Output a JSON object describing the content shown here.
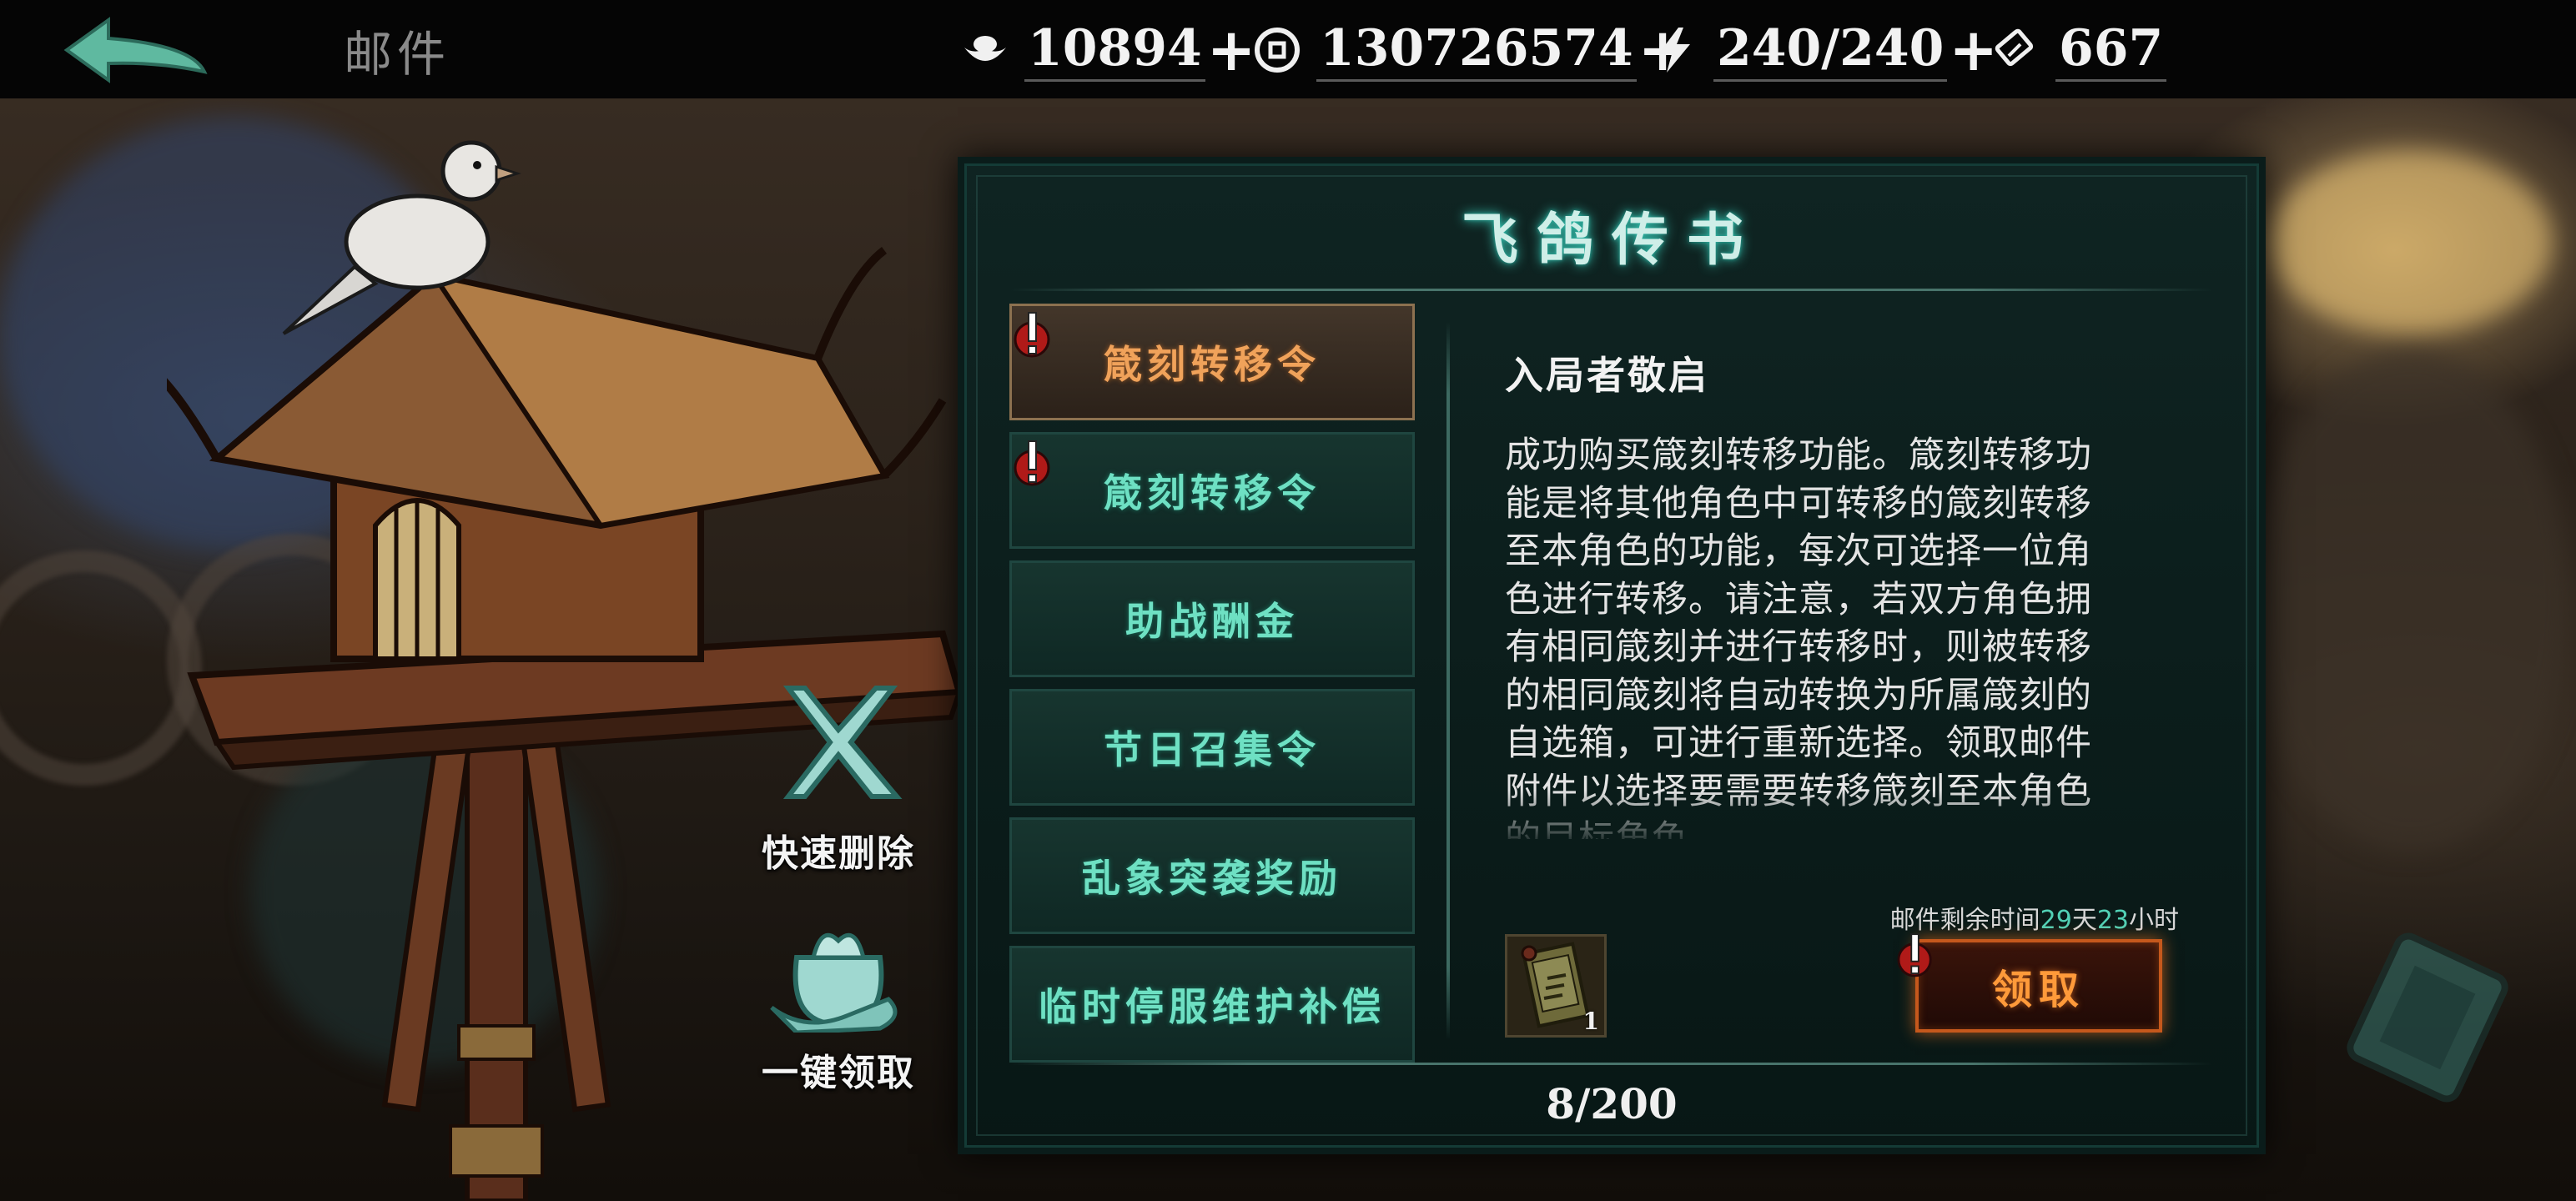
{
  "header": {
    "title": "邮件",
    "currencies": [
      {
        "icon": "ingot-icon",
        "value": "10894"
      },
      {
        "icon": "coin-icon",
        "value": "130726574"
      },
      {
        "icon": "lightning-icon",
        "value": "240/240"
      },
      {
        "icon": "ticket-icon",
        "value": "667"
      }
    ],
    "plus": "+"
  },
  "side_actions": {
    "quick_delete": "快速删除",
    "claim_all": "一键领取"
  },
  "panel": {
    "title": "飞鸽传书",
    "mails": [
      {
        "label": "箴刻转移令",
        "selected": true,
        "alert": true
      },
      {
        "label": "箴刻转移令",
        "selected": false,
        "alert": true
      },
      {
        "label": "助战酬金",
        "selected": false,
        "alert": false
      },
      {
        "label": "节日召集令",
        "selected": false,
        "alert": false
      },
      {
        "label": "乱象突袭奖励",
        "selected": false,
        "alert": false
      },
      {
        "label": "临时停服维护补偿",
        "selected": false,
        "alert": false
      }
    ],
    "detail": {
      "greeting": "入局者敬启",
      "lines": [
        "成功购买箴刻转移功能。箴刻转移功",
        "能是将其他角色中可转移的箴刻转移",
        "至本角色的功能，每次可选择一位角",
        "色进行转移。请注意，若双方角色拥",
        "有相同箴刻并进行转移时，则被转移",
        "的相同箴刻将自动转换为所属箴刻的",
        "自选箱，可进行重新选择。领取邮件",
        "附件以选择要需要转移箴刻至本角色",
        "的目标角色"
      ],
      "expire": {
        "prefix": "邮件剩余时间",
        "days": "29",
        "day_unit": "天",
        "hours": "23",
        "hour_unit": "小时"
      },
      "attachment": {
        "icon": "scroll-item-icon",
        "count": "1"
      },
      "claim_label": "领取"
    },
    "page_count": "8/200"
  },
  "colors": {
    "accent_teal": "#6ee0c3",
    "selected_orange": "#f0a25a",
    "claim_orange": "#ff9a3a",
    "alert_red": "#c0201c"
  }
}
